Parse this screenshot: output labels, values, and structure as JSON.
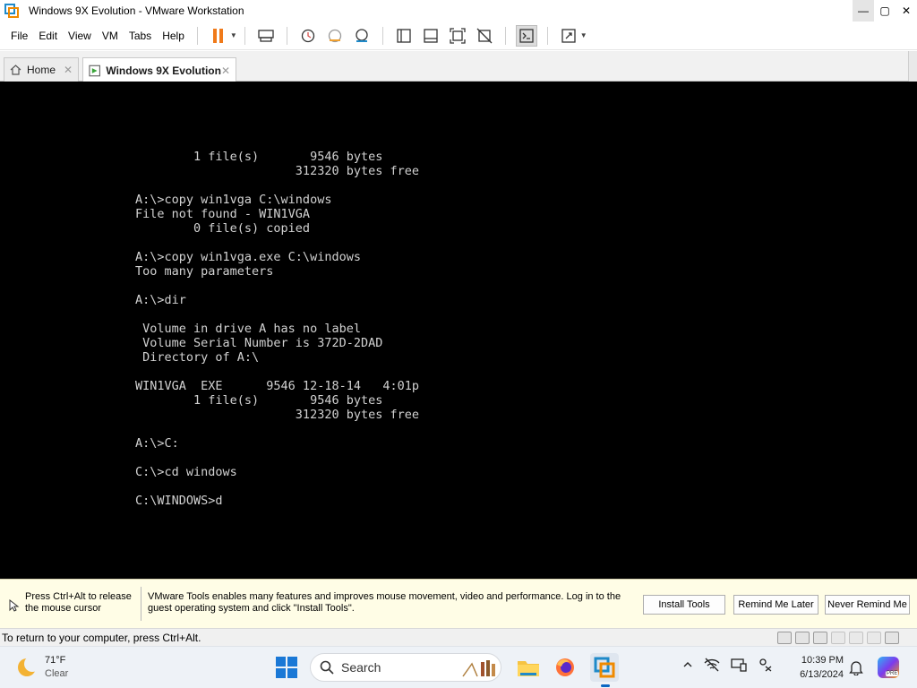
{
  "window": {
    "title": "Windows 9X Evolution - VMware Workstation",
    "controls": {
      "minimize": "—",
      "maximize": "▢",
      "close": "✕"
    }
  },
  "menu": [
    "File",
    "Edit",
    "View",
    "VM",
    "Tabs",
    "Help"
  ],
  "tabs": [
    {
      "label": "Home",
      "icon": "home-icon",
      "active": false
    },
    {
      "label": "Windows 9X Evolution",
      "icon": "vm-icon",
      "active": true
    }
  ],
  "console": {
    "lines": [
      "        1 file(s)       9546 bytes",
      "                      312320 bytes free",
      "",
      "A:\\>copy win1vga C:\\windows",
      "File not found - WIN1VGA",
      "        0 file(s) copied",
      "",
      "A:\\>copy win1vga.exe C:\\windows",
      "Too many parameters",
      "",
      "A:\\>dir",
      "",
      " Volume in drive A has no label",
      " Volume Serial Number is 372D-2DAD",
      " Directory of A:\\",
      "",
      "WIN1VGA  EXE      9546 12-18-14   4:01p",
      "        1 file(s)       9546 bytes",
      "                      312320 bytes free",
      "",
      "A:\\>C:",
      "",
      "C:\\>cd windows",
      "",
      "C:\\WINDOWS>d"
    ],
    "text_color": "#d2d2d2",
    "background": "#000000"
  },
  "notification": {
    "release_hint": "Press Ctrl+Alt to release the mouse cursor",
    "tools_message": "VMware Tools enables many features and improves mouse movement, video and performance. Log in to the guest operating system and click \"Install Tools\".",
    "buttons": {
      "install": "Install Tools",
      "remind": "Remind Me Later",
      "never": "Never Remind Me"
    }
  },
  "status": {
    "text": "To return to your computer, press Ctrl+Alt."
  },
  "taskbar": {
    "weather": {
      "temp": "71°F",
      "condition": "Clear"
    },
    "search_label": "Search",
    "clock": {
      "time": "10:39 PM",
      "date": "6/13/2024"
    },
    "copilot_badge": "PRE"
  },
  "colors": {
    "accent": "#1f8ac9",
    "pause": "#f07a1a",
    "notify_bg": "#fffde6",
    "taskbar_bg": "#eef2f7"
  }
}
